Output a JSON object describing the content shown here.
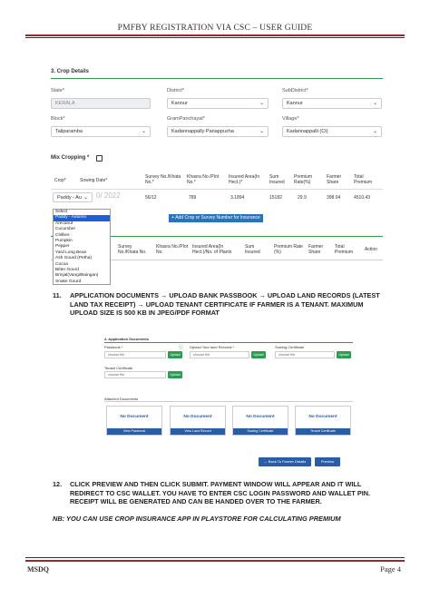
{
  "header": {
    "title": "PMFBY REGISTRATION VIA CSC – USER GUIDE"
  },
  "crop_form": {
    "section_title": "3. Crop Details",
    "state_label": "State*",
    "state_value": "KERALA",
    "district_label": "District*",
    "district_value": "Kannur",
    "subdistrict_label": "SubDistrict*",
    "subdistrict_value": "Kannur",
    "block_label": "Block*",
    "block_value": "Taliparamba",
    "gp_label": "GramPanchayat*",
    "gp_value": "Kadannappally  Panappuzha",
    "village_label": "Village*",
    "village_value": "Kadannappalli (Ct)",
    "mix_label": "Mix Cropping *",
    "table_headers": [
      "Crop*",
      "Sowing Date*",
      "Survey No./Khata No.*",
      "Khasra No./Plot No.*",
      "Insured Area(In Hect.)*",
      "Sum Insured",
      "Premium Rate(%)",
      "Farmer Share",
      "Total Premium"
    ],
    "row": {
      "crop": "Paddy - Au",
      "date": "0/ 2022",
      "survey": "56/12",
      "khasra": "789",
      "area": "3.1894",
      "sum": "15182",
      "rate": "29.9",
      "share": "398.04",
      "total": "4510.43"
    },
    "dropdown_options": [
      "Select",
      "Paddy - Autumn",
      "Arecanut",
      "Cucumber",
      "Chillies",
      "Pumpkin",
      "Pepper",
      "Yard Long Bean",
      "Ash Gourd (Petha)",
      "Cocoa",
      "Bitter Gourd",
      "Brinjal(Vangi/Baingan)",
      "Snake Gourd"
    ],
    "add_button": "+ Add Crop or Survey Number for Insurance",
    "table2_headers": [
      "Survey No./Khata No.",
      "Khasra No./Plot No.",
      "Insured Area(In Hect.)/No. of Plants",
      "Sum Insured",
      "Premium Rate (%)",
      "Farmer Share",
      "Total Premium",
      "Action"
    ]
  },
  "steps": [
    {
      "num": "11.",
      "text": "APPLICATION DOCUMENTS → UPLOAD BANK PASSBOOK → UPLOAD LAND RECORDS (LATEST LAND TAX RECEIPT) → UPLOAD TENANT CERTIFICATE IF FARMER IS A TENANT. MAXIMUM UPLOAD SIZE IS 500 KB IN JPEG/PDF FORMAT"
    },
    {
      "num": "12.",
      "text": "CLICK PREVIEW AND THEN CLICK SUBMIT. PAYMENT WINDOW WILL APPEAR AND IT WILL REDIRECT TO CSC WALLET. YOU HAVE TO ENTER CSC LOGIN PASSWORD AND WALLET PIN. RECEIPT WILL BE GENERATED AND CAN BE HANDED OVER TO THE FARMER."
    }
  ],
  "docs_form": {
    "section_title": "4. Application Documents",
    "passbook_label": "Passbook *",
    "land_label": "Upload Your land Records *",
    "sowing_label": "Sowing Certificate",
    "tenant_label": "Tenant Certificate",
    "choose_file": "choose file",
    "upload": "Upload",
    "attached_title": "Attached Documents",
    "no_document": "No Document",
    "cards": [
      "View Passbook",
      "View Land Record",
      "Sowing Certificate",
      "Tenant Certificate"
    ],
    "back_button": "← Back To Farmer Details",
    "preview_button": "Preview"
  },
  "note": "NB: YOU CAN USE CROP INSURANCE APP IN PLAYSTORE FOR CALCULATING PREMIUM",
  "footer": {
    "left": "MSDQ",
    "right": "Page 4"
  }
}
